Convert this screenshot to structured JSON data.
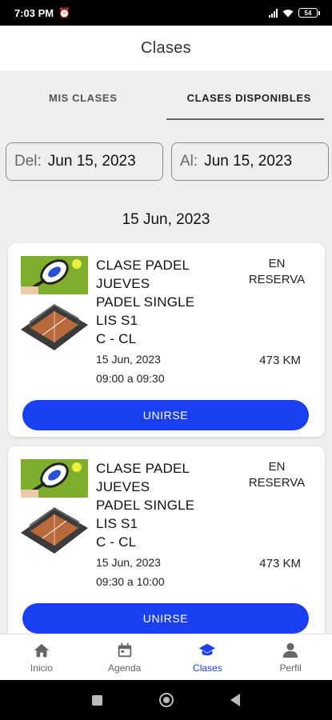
{
  "status_bar": {
    "time": "7:03 PM",
    "battery": "54"
  },
  "header": {
    "title": "Clases"
  },
  "tabs": [
    {
      "label": "MIS CLASES",
      "active": false
    },
    {
      "label": "CLASES DISPONIBLES",
      "active": true
    }
  ],
  "filters": {
    "from_label": "Del:",
    "from_value": "Jun 15, 2023",
    "to_label": "Al:",
    "to_value": "Jun 15, 2023"
  },
  "date_heading": "15 Jun, 2023",
  "classes": [
    {
      "title_1": "CLASE PADEL",
      "title_2": "JUEVES",
      "title_3": "PADEL SINGLE",
      "title_4": "LIS S1",
      "title_5": "C - CL",
      "date": "15 Jun, 2023",
      "time": "09:00 a 09:30",
      "status_1": "EN",
      "status_2": "RESERVA",
      "distance": "473 KM",
      "button": "UNIRSE"
    },
    {
      "title_1": "CLASE PADEL",
      "title_2": "JUEVES",
      "title_3": "PADEL SINGLE",
      "title_4": "LIS S1",
      "title_5": "C - CL",
      "date": "15 Jun, 2023",
      "time": "09:30 a 10:00",
      "status_1": "EN",
      "status_2": "RESERVA",
      "distance": "473 KM",
      "button": "UNIRSE"
    }
  ],
  "bottom_nav": [
    {
      "label": "Inicio",
      "icon": "home-icon"
    },
    {
      "label": "Agenda",
      "icon": "calendar-icon"
    },
    {
      "label": "Clases",
      "icon": "graduation-cap-icon",
      "active": true
    },
    {
      "label": "Perfil",
      "icon": "person-icon"
    }
  ],
  "colors": {
    "accent": "#1a3ff0",
    "background": "#efefef"
  }
}
